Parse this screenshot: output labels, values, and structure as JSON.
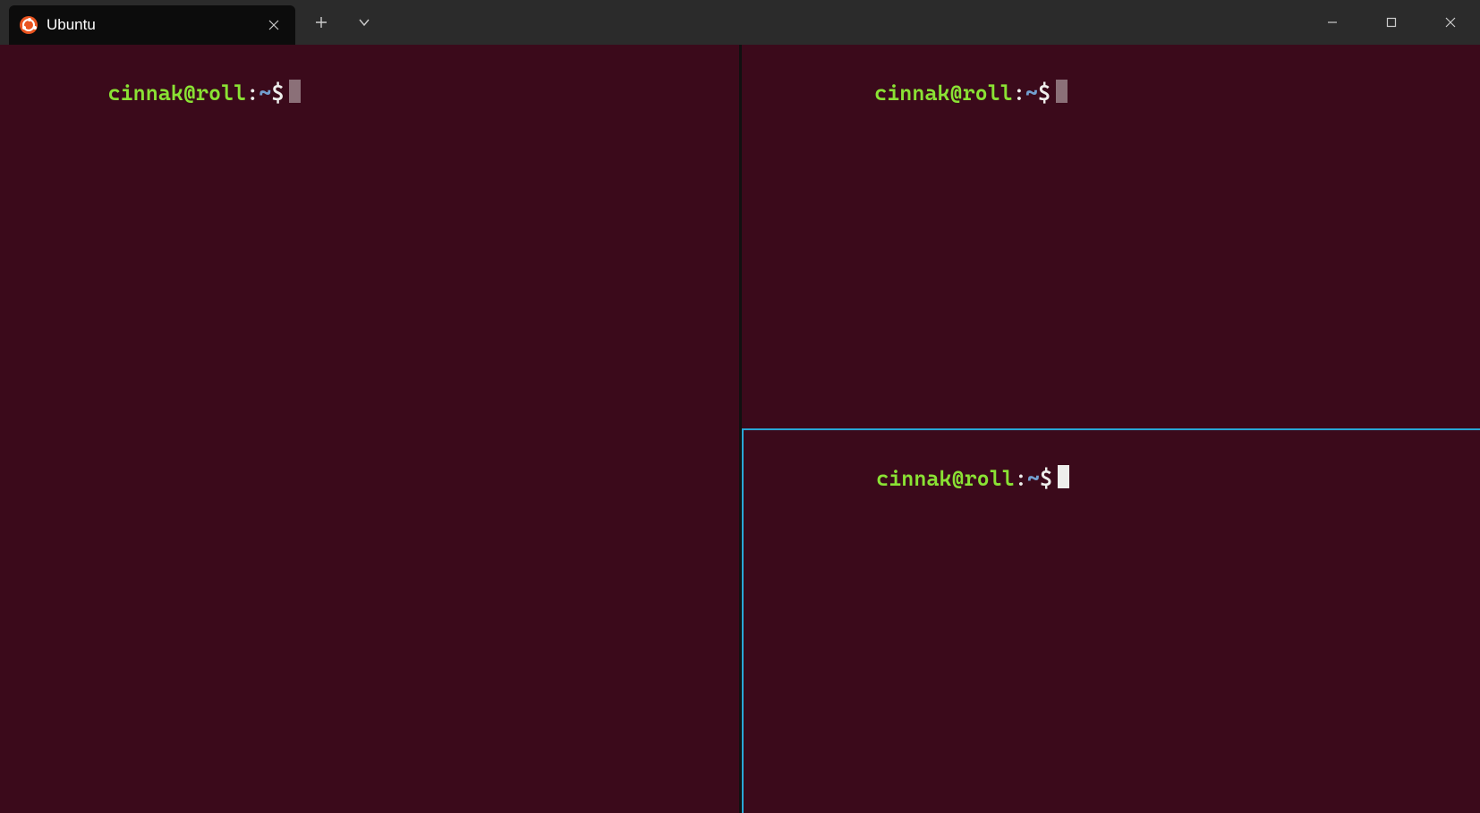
{
  "titlebar": {
    "tab_title": "Ubuntu"
  },
  "panes": {
    "left": {
      "user_host": "cinnak@roll",
      "colon": ":",
      "path": "~",
      "dollar": "$",
      "command": "",
      "active": false
    },
    "rt": {
      "user_host": "cinnak@roll",
      "colon": ":",
      "path": "~",
      "dollar": "$",
      "command": "",
      "active": false
    },
    "rb": {
      "user_host": "cinnak@roll",
      "colon": ":",
      "path": "~",
      "dollar": "$",
      "command": "",
      "active": true
    }
  },
  "colors": {
    "terminal_bg": "#3b0a1b",
    "prompt_user": "#8ae234",
    "prompt_path": "#729fcf",
    "prompt_text": "#eeeeec",
    "active_pane_border": "#29a6d4",
    "ubuntu_orange": "#E95420"
  }
}
